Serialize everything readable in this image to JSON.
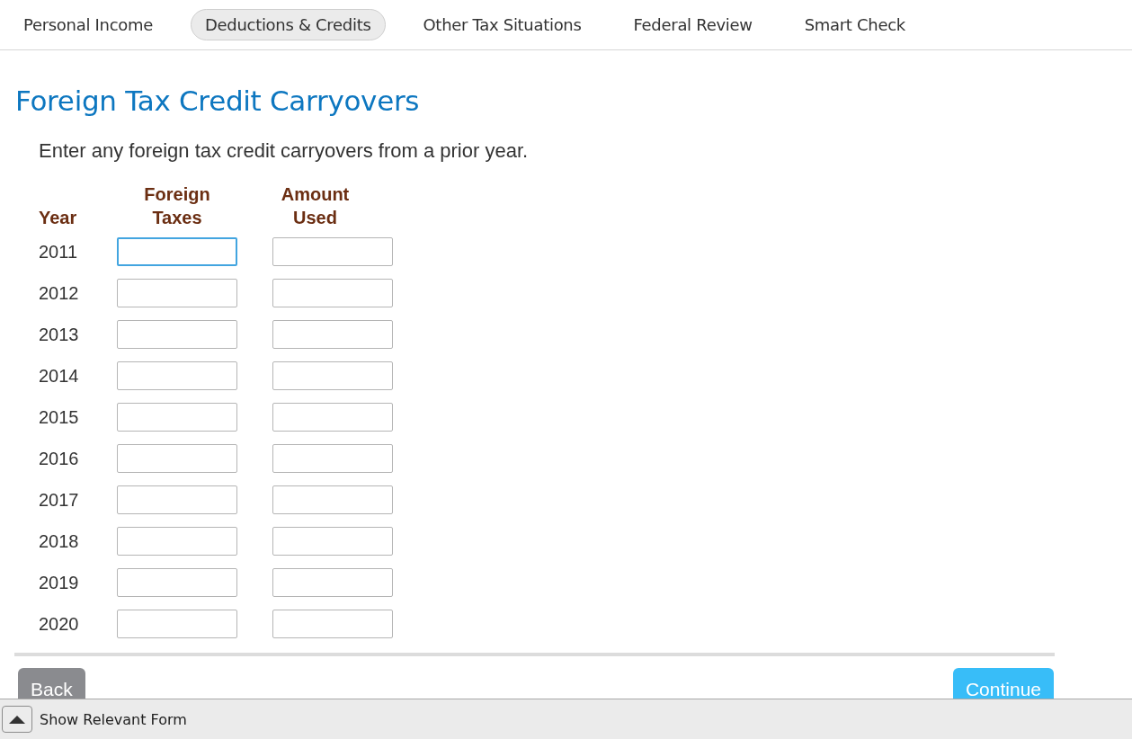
{
  "tabs": [
    {
      "label": "Personal Income",
      "selected": false
    },
    {
      "label": "Deductions & Credits",
      "selected": true
    },
    {
      "label": "Other Tax Situations",
      "selected": false
    },
    {
      "label": "Federal Review",
      "selected": false
    },
    {
      "label": "Smart Check",
      "selected": false
    }
  ],
  "title": "Foreign Tax Credit Carryovers",
  "instruction": "Enter any foreign tax credit carryovers from a prior year.",
  "table": {
    "columns": [
      [
        "Year"
      ],
      [
        "Foreign",
        "Taxes"
      ],
      [
        "Amount",
        "Used"
      ]
    ],
    "rows": [
      {
        "year": "2011",
        "fields": [
          {
            "focused": true
          },
          {
            "focused": false
          }
        ]
      },
      {
        "year": "2012",
        "fields": [
          {
            "focused": false
          },
          {
            "focused": false
          }
        ]
      },
      {
        "year": "2013",
        "fields": [
          {
            "focused": false
          },
          {
            "focused": false
          }
        ]
      },
      {
        "year": "2014",
        "fields": [
          {
            "focused": false
          },
          {
            "focused": false
          }
        ]
      },
      {
        "year": "2015",
        "fields": [
          {
            "focused": false
          },
          {
            "focused": false
          }
        ]
      },
      {
        "year": "2016",
        "fields": [
          {
            "focused": false
          },
          {
            "focused": false
          }
        ]
      },
      {
        "year": "2017",
        "fields": [
          {
            "focused": false
          },
          {
            "focused": false
          }
        ]
      },
      {
        "year": "2018",
        "fields": [
          {
            "focused": false
          },
          {
            "focused": false
          }
        ]
      },
      {
        "year": "2019",
        "fields": [
          {
            "focused": false
          },
          {
            "focused": false
          }
        ]
      },
      {
        "year": "2020",
        "fields": [
          {
            "focused": false
          },
          {
            "focused": false
          }
        ]
      }
    ]
  },
  "buttons": {
    "back": "Back",
    "continue": "Continue"
  },
  "footer": {
    "label": "Show Relevant Form"
  }
}
